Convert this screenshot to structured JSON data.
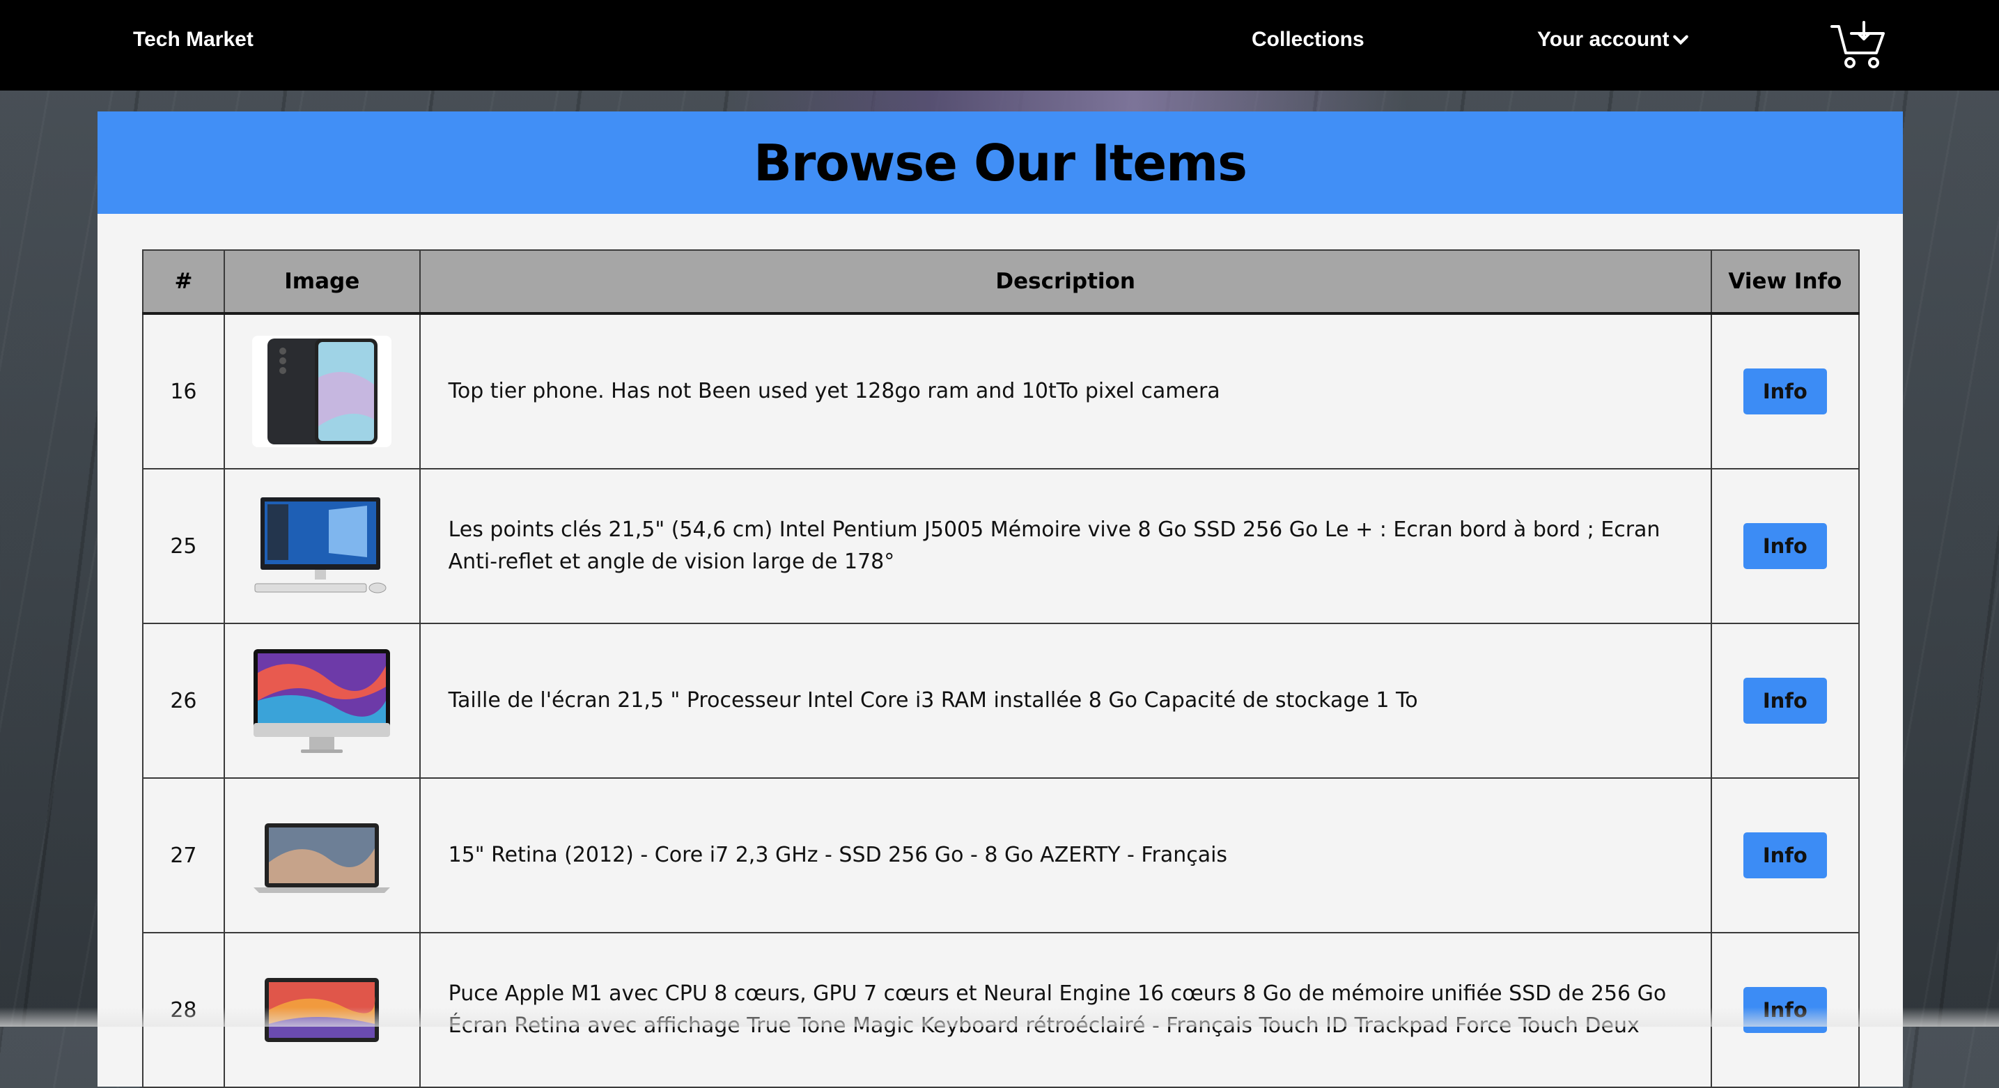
{
  "navbar": {
    "brand": "Tech Market",
    "collections_label": "Collections",
    "account_label": "Your account",
    "account_icon": "chevron-down-icon",
    "cart_icon": "cart-download-icon"
  },
  "page": {
    "title": "Browse Our Items",
    "accent_color": "#418ff6",
    "button_color": "#3c8cf5"
  },
  "table": {
    "headers": {
      "num": "#",
      "image": "Image",
      "description": "Description",
      "view": "View Info"
    },
    "rows": [
      {
        "num": "16",
        "image": "phone-thumbnail",
        "description": "Top tier phone. Has not Been used yet 128go ram and 10tTo pixel camera",
        "button": "Info"
      },
      {
        "num": "25",
        "image": "desktop-pc-thumbnail",
        "description": "Les points clés 21,5\" (54,6 cm) Intel Pentium J5005 Mémoire vive 8 Go SSD 256 Go Le + : Ecran bord à bord ; Ecran Anti-reflet et angle de vision large de 178°",
        "button": "Info"
      },
      {
        "num": "26",
        "image": "imac-thumbnail",
        "description": "Taille de l'écran 21,5 \" Processeur Intel Core i3 RAM installée 8 Go Capacité de stockage 1 To",
        "button": "Info"
      },
      {
        "num": "27",
        "image": "macbook-pro-thumbnail",
        "description": "15\" Retina (2012) - Core i7 2,3 GHz - SSD 256 Go - 8 Go AZERTY - Français",
        "button": "Info"
      },
      {
        "num": "28",
        "image": "macbook-air-thumbnail",
        "description": "Puce Apple M1 avec CPU 8 cœurs, GPU 7 cœurs et Neural Engine 16 cœurs 8 Go de mémoire unifiée SSD de 256 Go Écran Retina avec affichage True Tone Magic Keyboard rétroéclairé - Français Touch ID Trackpad Force Touch Deux",
        "button": "Info"
      }
    ]
  }
}
